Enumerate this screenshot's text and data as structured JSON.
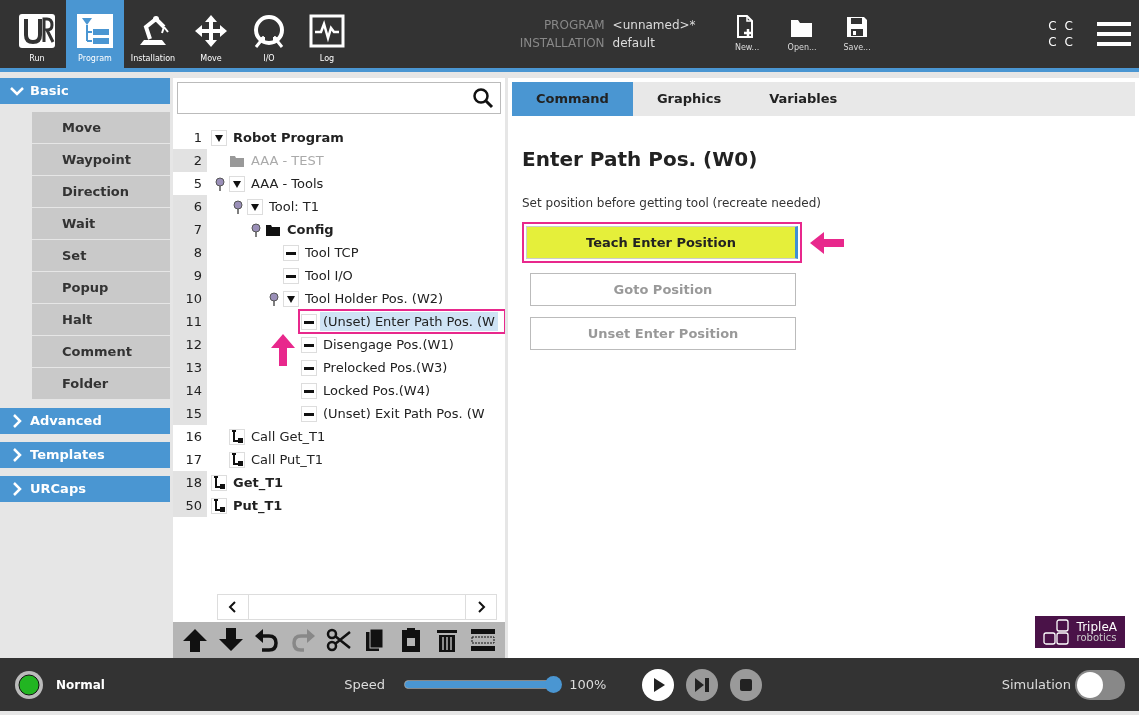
{
  "header": {
    "nav": [
      {
        "kind": "run",
        "label": "Run",
        "selected": false
      },
      {
        "kind": "program",
        "label": "Program",
        "selected": true
      },
      {
        "kind": "installation",
        "label": "Installation",
        "selected": false
      },
      {
        "kind": "move",
        "label": "Move",
        "selected": false
      },
      {
        "kind": "io",
        "label": "I/O",
        "selected": false
      },
      {
        "kind": "log",
        "label": "Log",
        "selected": false
      }
    ],
    "program_label": "PROGRAM",
    "program_value": "<unnamed>*",
    "installation_label": "INSTALLATION",
    "installation_value": "default",
    "file_buttons": [
      {
        "kind": "new",
        "label": "New..."
      },
      {
        "kind": "open",
        "label": "Open..."
      },
      {
        "kind": "save",
        "label": "Save..."
      }
    ],
    "corner_marks": [
      "C",
      "C",
      "C",
      "C"
    ]
  },
  "sidebar": {
    "groups": [
      {
        "label": "Basic",
        "expanded": true,
        "items": [
          "Move",
          "Waypoint",
          "Direction",
          "Wait",
          "Set",
          "Popup",
          "Halt",
          "Comment",
          "Folder"
        ]
      },
      {
        "label": "Advanced",
        "expanded": false
      },
      {
        "label": "Templates",
        "expanded": false
      },
      {
        "label": "URCaps",
        "expanded": false
      }
    ]
  },
  "tree": {
    "rows": [
      {
        "line": "1",
        "label": "Robot Program",
        "kind": "container",
        "expanded": true,
        "bold": true,
        "disabled": false,
        "selected": false,
        "pin": false,
        "shaded": false,
        "children": [
          {
            "line": "2",
            "label": "AAA - TEST",
            "kind": "folder",
            "bold": false,
            "disabled": true,
            "selected": false,
            "pin": false,
            "shaded": true
          },
          {
            "line": "5",
            "label": "AAA - Tools",
            "kind": "container",
            "expanded": true,
            "bold": false,
            "disabled": false,
            "selected": false,
            "pin": true,
            "shaded": false,
            "children": [
              {
                "line": "6",
                "label": "Tool: T1",
                "kind": "container",
                "expanded": true,
                "bold": false,
                "disabled": false,
                "selected": false,
                "pin": true,
                "shaded": true,
                "children": [
                  {
                    "line": "7",
                    "label": "Config",
                    "kind": "folder",
                    "bold": true,
                    "disabled": false,
                    "selected": false,
                    "pin": true,
                    "shaded": true,
                    "children": [
                      {
                        "line": "8",
                        "label": "Tool TCP",
                        "kind": "waypoint",
                        "bold": false,
                        "disabled": false,
                        "selected": false,
                        "pin": false,
                        "shaded": true
                      },
                      {
                        "line": "9",
                        "label": "Tool I/O",
                        "kind": "waypoint",
                        "bold": false,
                        "disabled": false,
                        "selected": false,
                        "pin": false,
                        "shaded": true
                      },
                      {
                        "line": "10",
                        "label": "Tool Holder Pos. (W2)",
                        "kind": "container",
                        "expanded": true,
                        "bold": false,
                        "disabled": false,
                        "selected": false,
                        "pin": true,
                        "shaded": true,
                        "children": [
                          {
                            "line": "11",
                            "label": "(Unset) Enter Path Pos. (W",
                            "kind": "waypoint",
                            "bold": false,
                            "disabled": false,
                            "selected": true,
                            "pin": false,
                            "shaded": true
                          },
                          {
                            "line": "12",
                            "label": "Disengage Pos.(W1)",
                            "kind": "waypoint",
                            "bold": false,
                            "disabled": false,
                            "selected": false,
                            "pin": false,
                            "shaded": true
                          },
                          {
                            "line": "13",
                            "label": "Prelocked Pos.(W3)",
                            "kind": "waypoint",
                            "bold": false,
                            "disabled": false,
                            "selected": false,
                            "pin": false,
                            "shaded": true
                          },
                          {
                            "line": "14",
                            "label": "Locked Pos.(W4)",
                            "kind": "waypoint",
                            "bold": false,
                            "disabled": false,
                            "selected": false,
                            "pin": false,
                            "shaded": true
                          },
                          {
                            "line": "15",
                            "label": "(Unset) Exit Path Pos. (W",
                            "kind": "waypoint",
                            "bold": false,
                            "disabled": false,
                            "selected": false,
                            "pin": false,
                            "shaded": true
                          }
                        ]
                      }
                    ]
                  }
                ]
              }
            ]
          },
          {
            "line": "16",
            "label": "Call Get_T1",
            "kind": "call",
            "bold": false,
            "disabled": false,
            "selected": false,
            "pin": false,
            "shaded": false
          },
          {
            "line": "17",
            "label": "Call Put_T1",
            "kind": "call",
            "bold": false,
            "disabled": false,
            "selected": false,
            "pin": false,
            "shaded": false
          }
        ]
      },
      {
        "line": "18",
        "label": "Get_T1",
        "kind": "call",
        "bold": true,
        "disabled": false,
        "selected": false,
        "pin": false,
        "shaded": true
      },
      {
        "line": "50",
        "label": "Put_T1",
        "kind": "call",
        "bold": true,
        "disabled": false,
        "selected": false,
        "pin": false,
        "shaded": true
      }
    ],
    "toolbar": [
      {
        "kind": "up",
        "disabled": false
      },
      {
        "kind": "down",
        "disabled": false
      },
      {
        "kind": "undo",
        "disabled": false
      },
      {
        "kind": "redo",
        "disabled": true
      },
      {
        "kind": "cut",
        "disabled": false
      },
      {
        "kind": "copy",
        "disabled": false
      },
      {
        "kind": "paste",
        "disabled": false
      },
      {
        "kind": "delete",
        "disabled": false
      },
      {
        "kind": "suppress",
        "disabled": false
      }
    ]
  },
  "tabs": [
    {
      "label": "Command",
      "selected": true
    },
    {
      "label": "Graphics",
      "selected": false
    },
    {
      "label": "Variables",
      "selected": false
    }
  ],
  "command": {
    "title": "Enter Path Pos. (W0)",
    "description": "Set position before getting tool (recreate needed)",
    "buttons": [
      {
        "label": "Teach Enter Position",
        "kind": "teach",
        "disabled": false
      },
      {
        "label": "Goto Position",
        "kind": "plain",
        "disabled": true
      },
      {
        "label": "Unset Enter Position",
        "kind": "plain",
        "disabled": true
      }
    ]
  },
  "logo": {
    "name": "TripleA",
    "subtitle": "robotics"
  },
  "footer": {
    "status": "Normal",
    "speed_label": "Speed",
    "speed": {
      "level": 1.0,
      "reading": "100%"
    },
    "controls": [
      {
        "kind": "play",
        "disabled": false
      },
      {
        "kind": "step",
        "disabled": true
      },
      {
        "kind": "stop",
        "disabled": true
      }
    ],
    "simulation_label": "Simulation",
    "simulation": {
      "on": false
    }
  }
}
